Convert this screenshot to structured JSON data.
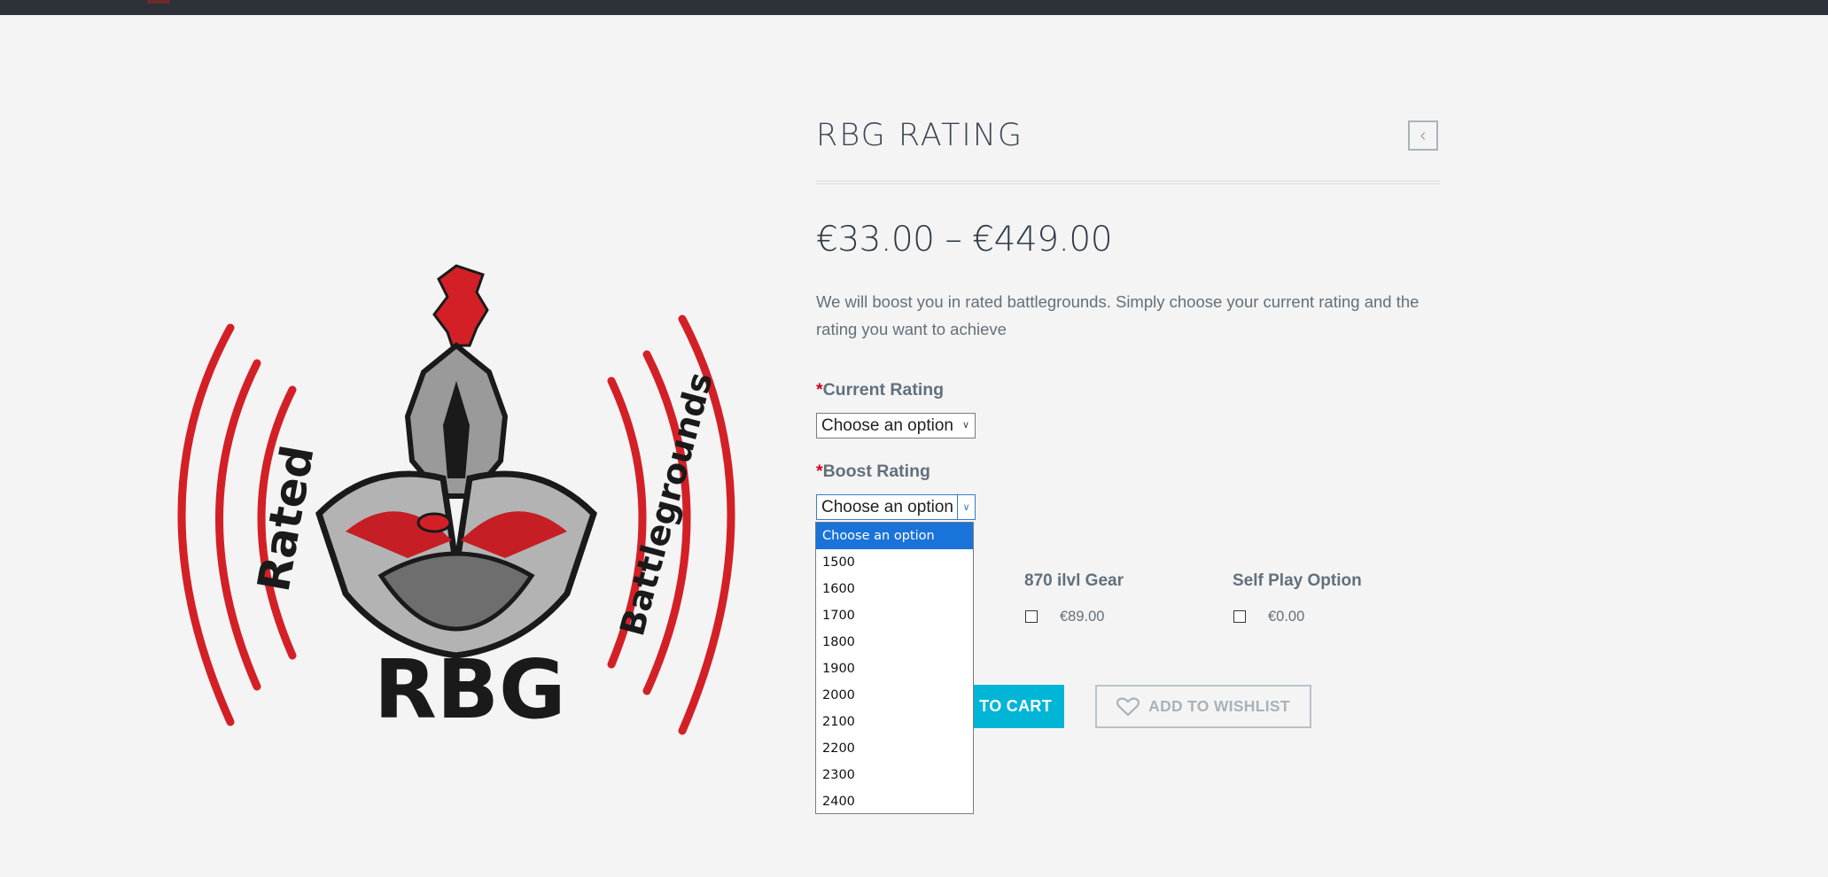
{
  "product": {
    "title": "RBG RATING",
    "price": "€33.00 – €449.00",
    "description": "We will boost you in rated battlegrounds. Simply choose your current rating and the rating you want to achieve",
    "back_icon": "chevron-left-icon"
  },
  "image": {
    "logo_text_left": "Rated",
    "logo_text_right": "Battlegrounds",
    "logo_text_bottom": "RBG",
    "colors": {
      "red": "#d32027",
      "dark": "#1a1a1a",
      "grey": "#8a8a8a"
    }
  },
  "form": {
    "required_mark": "*",
    "current_rating": {
      "label": "Current Rating",
      "value": "Choose an option"
    },
    "boost_rating": {
      "label": "Boost Rating",
      "value": "Choose an option"
    },
    "dropdown_options": [
      "Choose an option",
      "1500",
      "1600",
      "1700",
      "1800",
      "1900",
      "2000",
      "2100",
      "2200",
      "2300",
      "2400"
    ],
    "selected_option": "Choose an option"
  },
  "addons": [
    {
      "title": "870 ilvl Gear",
      "price": "€89.00",
      "checked": false
    },
    {
      "title": "Self Play Option",
      "price": "€0.00",
      "checked": false
    }
  ],
  "actions": {
    "add_to_cart": "TO CART",
    "add_to_wishlist": "ADD TO WISHLIST"
  },
  "colors": {
    "accent": "#00b5d6",
    "required": "#d0021b",
    "topbar": "#2d3139",
    "selected_option": "#1a73d9"
  }
}
